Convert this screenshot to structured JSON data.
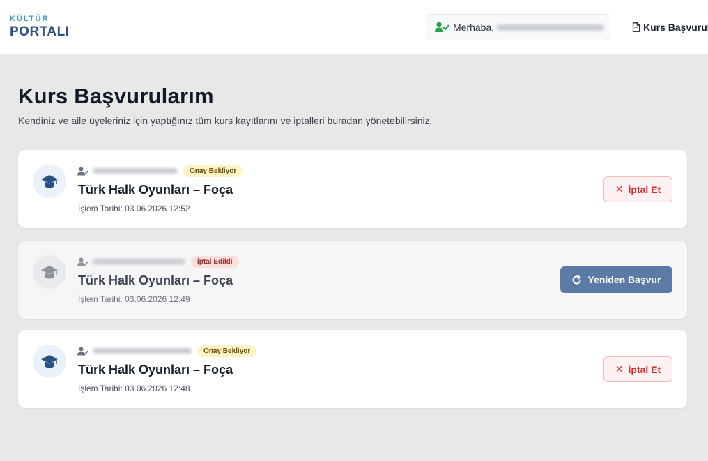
{
  "header": {
    "logo_top": "KÜLTÜR",
    "logo_bottom": "PORTALI",
    "greeting": "Merhaba,",
    "nav_link": "Kurs Başvurul"
  },
  "page": {
    "title": "Kurs Başvurularım",
    "subtitle": "Kendiniz ve aile üyeleriniz için yaptığınız tüm kurs kayıtlarını ve iptalleri buradan yönetebilirsiniz."
  },
  "applications": [
    {
      "status": "Onay Bekliyor",
      "course": "Türk Halk Oyunları – Foça",
      "date": "İşlem Tarihi: 03.06.2026 12:52",
      "action": "İptal Et"
    },
    {
      "status": "İptal Edildi",
      "course": "Türk Halk Oyunları – Foça",
      "date": "İşlem Tarihi: 03.06.2026 12:49",
      "action": "Yeniden Başvur"
    },
    {
      "status": "Onay Bekliyor",
      "course": "Türk Halk Oyunları – Foça",
      "date": "İşlem Tarihi: 03.06.2026 12:48",
      "action": "İptal Et"
    }
  ],
  "icons": {
    "user_check": "user-check-icon",
    "document": "document-icon",
    "graduation_cap": "graduation-cap-icon",
    "user_edit": "user-edit-icon",
    "close": "close-icon",
    "refresh": "refresh-icon"
  },
  "colors": {
    "brand": "#2b4f82",
    "accent": "#3b97c6",
    "danger": "#d42b2b",
    "reapply": "#5b7aa6",
    "pending_badge": "#fdf3c4",
    "cancelled_badge": "#fbdede"
  }
}
